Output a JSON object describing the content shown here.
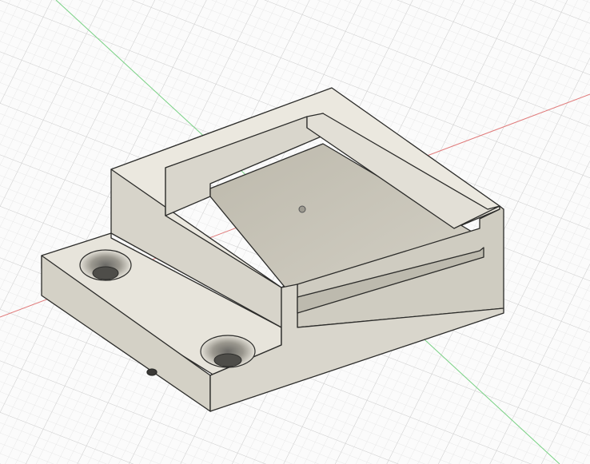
{
  "viewport": {
    "background": "#fbfbfb",
    "grid_minor_color": "#e6e6e6",
    "grid_major_color": "#d2d2d2",
    "axis_x_color": "#d96a6a",
    "axis_y_color": "#6fcf7a"
  },
  "model": {
    "body_top_color": "#e8e5dc",
    "body_front_color": "#d6d3c9",
    "body_side_color": "#c9c6bb",
    "pocket_floor_color": "#c7c4b8",
    "pocket_wall_color": "#d9d6cc",
    "edge_color": "#2c2c2a",
    "mounting_holes": 2
  }
}
